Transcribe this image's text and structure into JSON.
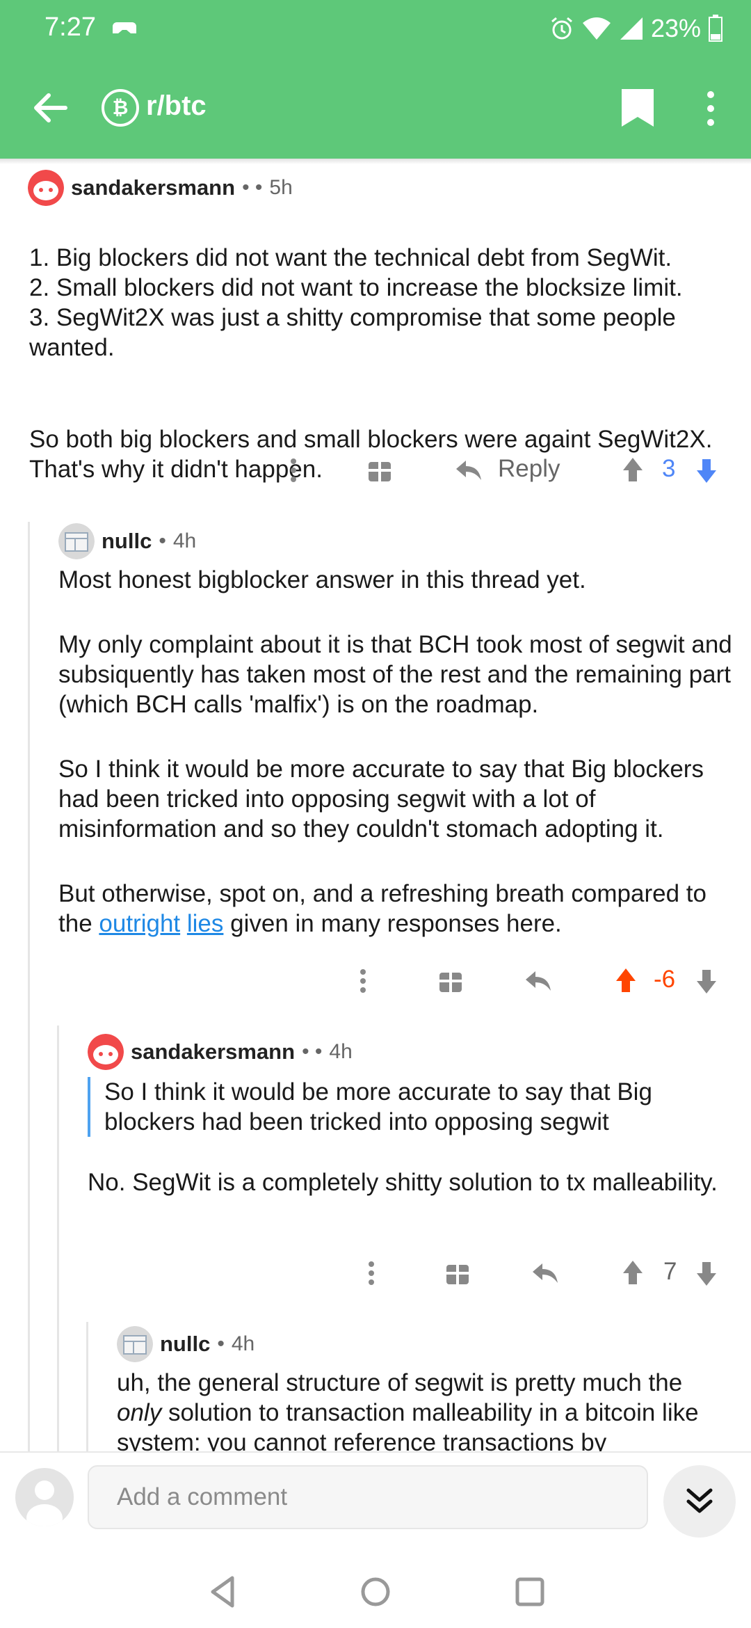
{
  "status_bar": {
    "time": "7:27",
    "battery": "23%"
  },
  "app_bar": {
    "subreddit": "r/btc",
    "subreddit_icon": "bitcoin-icon"
  },
  "comments": [
    {
      "author": "sandakersmann",
      "age": "5h",
      "paragraphs": [
        "1. Big blockers did not want the technical debt from SegWit.\n2. Small blockers did not want to increase the blocksize limit.\n3. SegWit2X was just a shitty compromise that some people wanted.",
        "So both big blockers and small blockers were againt SegWit2X. That's why it didn't happen."
      ],
      "reply_label": "Reply",
      "score": "3"
    },
    {
      "author": "nullc",
      "age": "4h",
      "paragraphs": [
        "Most honest bigblocker answer in this thread yet.",
        "My only complaint about it is that BCH took most of segwit and subsiquently has taken most of the rest and the remaining part (which BCH calls 'malfix') is on the roadmap.",
        "So I think it would be more accurate to say that Big blockers had been tricked into opposing segwit with a lot of misinformation and so they couldn't stomach adopting it."
      ],
      "last_paragraph": {
        "before": "But otherwise, spot on, and a refreshing breath compared to the ",
        "link1": "outright",
        "link2": "lies",
        "after": " given in many responses here."
      },
      "score": "-6"
    },
    {
      "author": "sandakersmann",
      "age": "4h",
      "quote": "So I think it would be more accurate to say that Big blockers had been tricked into opposing segwit",
      "paragraphs": [
        "No. SegWit is a completely shitty solution to tx malleability."
      ],
      "score": "7"
    },
    {
      "author": "nullc",
      "age": "4h",
      "text_before": "uh, the general structure of segwit is pretty much the ",
      "text_em": "only",
      "text_after": " solution to transaction malleability in a bitcoin like system: you cannot reference transactions by"
    }
  ],
  "comment_bar": {
    "placeholder": "Add a comment"
  },
  "colors": {
    "header": "#5ec879",
    "upvote": "#ff4500",
    "downvote": "#4f86f7",
    "link": "#1e88e5",
    "quote_bar": "#4ea2f0"
  }
}
